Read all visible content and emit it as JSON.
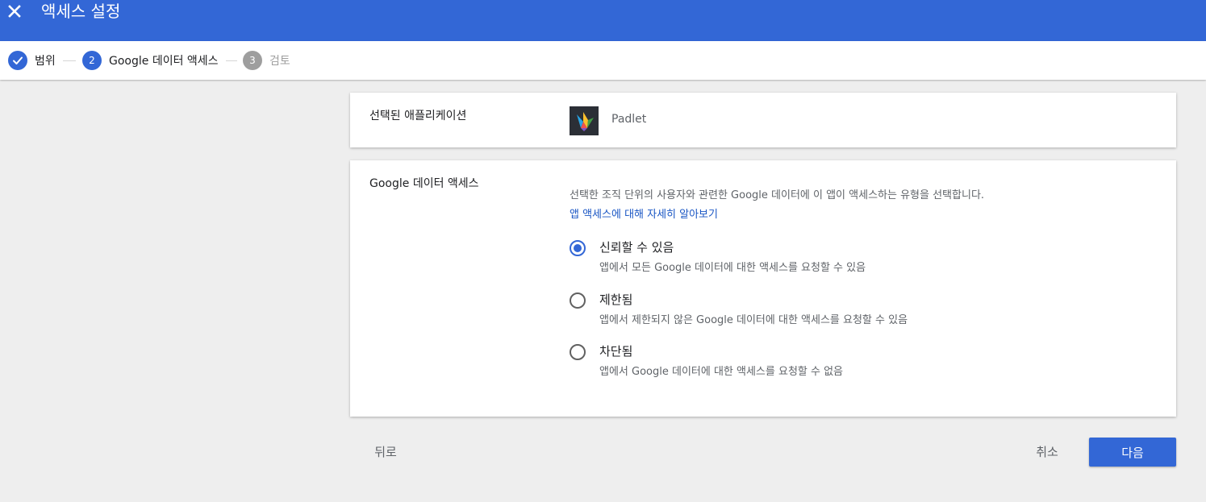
{
  "colors": {
    "accent": "#3367d6",
    "link": "#1a56c4",
    "background": "#eeeeee",
    "inactive_step": "#9e9e9e"
  },
  "header": {
    "close_icon": "close-icon",
    "title": "액세스 설정"
  },
  "stepper": {
    "steps": [
      {
        "number": "",
        "icon": "check-icon",
        "label": "범위",
        "state": "completed"
      },
      {
        "number": "2",
        "label": "Google 데이터 액세스",
        "state": "active"
      },
      {
        "number": "3",
        "label": "검토",
        "state": "upcoming"
      }
    ]
  },
  "selected_app": {
    "label": "선택된 애플리케이션",
    "app_icon": "padlet-logo-icon",
    "app_name": "Padlet"
  },
  "data_access": {
    "label": "Google 데이터 액세스",
    "description": "선택한 조직 단위의 사용자와 관련한 Google 데이터에 이 앱이 액세스하는 유형을 선택합니다.",
    "learn_more": "앱 액세스에 대해 자세히 알아보기",
    "options": [
      {
        "title": "신뢰할 수 있음",
        "subtitle": "앱에서 모든 Google 데이터에 대한 액세스를 요청할 수 있음",
        "selected": true
      },
      {
        "title": "제한됨",
        "subtitle": "앱에서 제한되지 않은 Google 데이터에 대한 액세스를 요청할 수 있음",
        "selected": false
      },
      {
        "title": "차단됨",
        "subtitle": "앱에서 Google 데이터에 대한 액세스를 요청할 수 없음",
        "selected": false
      }
    ]
  },
  "footer": {
    "back": "뒤로",
    "cancel": "취소",
    "next": "다음"
  }
}
